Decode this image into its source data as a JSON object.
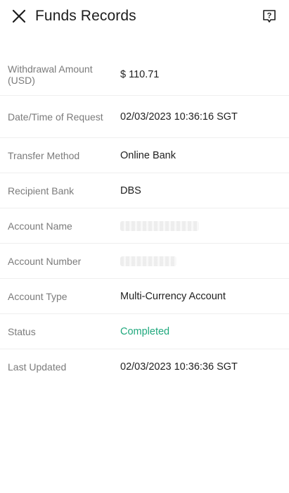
{
  "header": {
    "title": "Funds Records",
    "close_icon": "close-icon",
    "help_icon": "help-icon"
  },
  "colors": {
    "status_completed": "#1fa87d",
    "label": "#7b7b7b",
    "value": "#1f1f1f"
  },
  "details": {
    "withdrawal_amount": {
      "label": "Withdrawal Amount (USD)",
      "value": "$ 110.71"
    },
    "request_datetime": {
      "label": "Date/Time of Request",
      "value": "02/03/2023 10:36:16 SGT"
    },
    "transfer_method": {
      "label": "Transfer Method",
      "value": "Online Bank"
    },
    "recipient_bank": {
      "label": "Recipient Bank",
      "value": "DBS"
    },
    "account_name": {
      "label": "Account Name"
    },
    "account_number": {
      "label": "Account Number"
    },
    "account_type": {
      "label": "Account Type",
      "value": "Multi-Currency Account"
    },
    "status": {
      "label": "Status",
      "value": "Completed"
    },
    "last_updated": {
      "label": "Last Updated",
      "value": "02/03/2023 10:36:36 SGT"
    }
  }
}
